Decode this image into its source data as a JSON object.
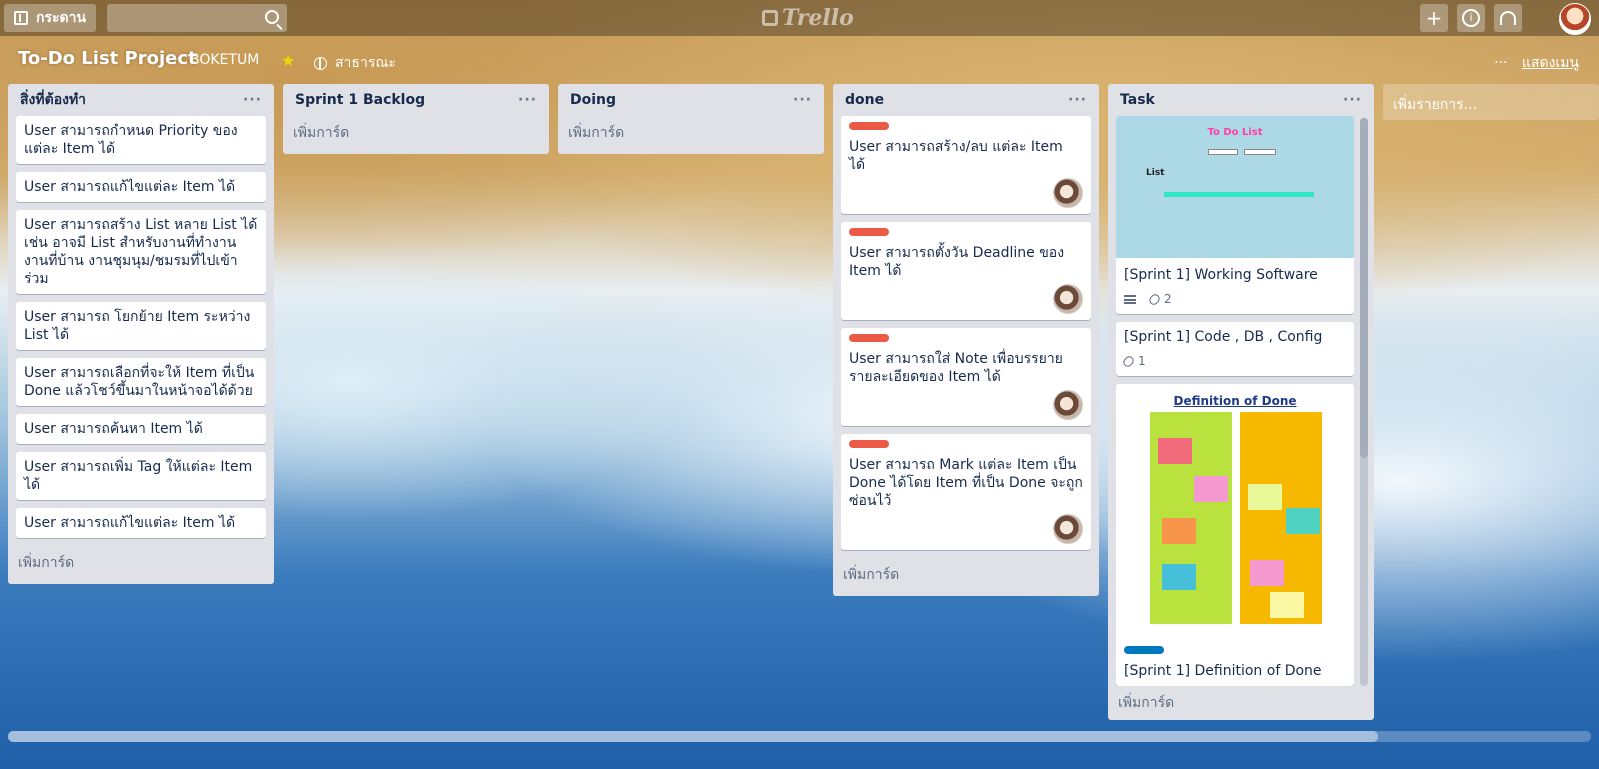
{
  "header": {
    "boards_label": "กระดาน",
    "search_placeholder": "",
    "logo_text": "Trello"
  },
  "board": {
    "title": "To-Do List Project",
    "team": "BOKETUM",
    "visibility": "สาธารณะ",
    "menu_label": "แสดงเมนู",
    "menu_dots": "···",
    "list_menu": "···",
    "add_list": "เพิ่มรายการ..."
  },
  "lists": [
    {
      "title": "สิ่งที่ต้องทำ",
      "add_card": "เพิ่มการ์ด",
      "cards": [
        "User สามารถกำหนด Priority ของแต่ละ Item ได้",
        "User สามารถแก้ไขแต่ละ Item ได้",
        "User สามารถสร้าง List หลาย List ได้ เช่น อาจมี List สำหรับงานที่ทำงาน งานที่บ้าน งานชุมนุม/ชมรมที่ไปเข้าร่วม",
        "User สามารถ โยกย้าย Item ระหว่าง List ได้",
        "User สามารถเลือกที่จะให้ Item ที่เป็น Done แล้วโชว์ขึ้นมาในหน้าจอได้ด้วย",
        "User สามารถค้นหา Item ได้",
        "User สามารถเพิ่ม Tag ให้แต่ละ Item ได้",
        "User สามารถแก้ไขแต่ละ Item ได้"
      ]
    },
    {
      "title": "Sprint 1 Backlog",
      "add_card": "เพิ่มการ์ด",
      "cards": []
    },
    {
      "title": "Doing",
      "add_card": "เพิ่มการ์ด",
      "cards": []
    },
    {
      "title": "done",
      "add_card": "เพิ่มการ์ด",
      "label_color": "#eb5a46",
      "cards": [
        "User สามารถสร้าง/ลบ แต่ละ Item ได้",
        "User สามารถตั้งวัน Deadline ของ Item ได้",
        "User สามารถใส่ Note เพื่อบรรยายรายละเอียดของ Item ได้",
        "User สามารถ Mark แต่ละ Item เป็น Done ได้โดย Item ที่เป็น Done จะถูกซ่อนไว้"
      ]
    },
    {
      "title": "Task",
      "add_card": "เพิ่มการ์ด",
      "cards": [
        {
          "title": "[Sprint 1] Working Software",
          "attachments": "2",
          "cover_title": "To Do List",
          "cover_list": "List"
        },
        {
          "title": "[Sprint 1] Code , DB , Config",
          "attachments": "1"
        },
        {
          "title": "[Sprint 1] Definition of Done",
          "label_color": "#0079bf",
          "cover_title": "Definition of Done"
        }
      ]
    }
  ],
  "colors": {
    "list_bg": "#dfe1e6",
    "label_red": "#eb5a46",
    "label_blue": "#0079bf",
    "star": "#f2d600"
  },
  "icons": [
    "boards-icon",
    "search-icon",
    "trello-logo-icon",
    "plus-icon",
    "info-icon",
    "bell-icon",
    "avatar",
    "star-icon",
    "globe-icon",
    "description-icon",
    "attachment-icon"
  ]
}
